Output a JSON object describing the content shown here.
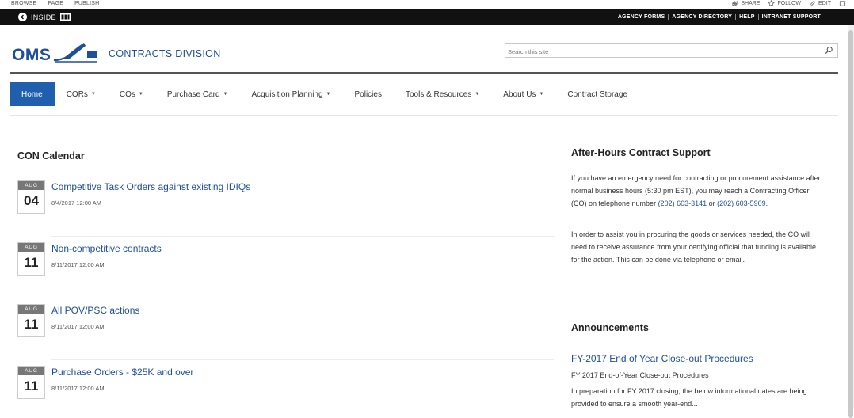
{
  "ribbon": {
    "tabs": [
      "BROWSE",
      "PAGE",
      "PUBLISH"
    ],
    "share": "SHARE",
    "follow": "FOLLOW",
    "edit": "EDIT"
  },
  "topbar": {
    "inside_label": "INSIDE",
    "links": [
      "AGENCY FORMS",
      "AGENCY DIRECTORY",
      "HELP",
      "INTRANET SUPPORT"
    ]
  },
  "header": {
    "logo_text": "OMS",
    "division": "CONTRACTS DIVISION",
    "search_placeholder": "Search this site"
  },
  "nav": {
    "items": [
      {
        "label": "Home",
        "dropdown": false,
        "active": true
      },
      {
        "label": "CORs",
        "dropdown": true
      },
      {
        "label": "COs",
        "dropdown": true
      },
      {
        "label": "Purchase Card",
        "dropdown": true
      },
      {
        "label": "Acquisition Planning",
        "dropdown": true
      },
      {
        "label": "Policies",
        "dropdown": false
      },
      {
        "label": "Tools & Resources",
        "dropdown": true
      },
      {
        "label": "About Us",
        "dropdown": true
      },
      {
        "label": "Contract Storage",
        "dropdown": false
      }
    ],
    "caret": "▼"
  },
  "calendar": {
    "title": "CON Calendar",
    "events": [
      {
        "month": "AUG",
        "day": "04",
        "title": "Competitive Task Orders against existing IDIQs",
        "time": "8/4/2017 12:00 AM"
      },
      {
        "month": "AUG",
        "day": "11",
        "title": "Non-competitive contracts",
        "time": "8/11/2017 12:00 AM"
      },
      {
        "month": "AUG",
        "day": "11",
        "title": "All POV/PSC actions",
        "time": "8/11/2017 12:00 AM"
      },
      {
        "month": "AUG",
        "day": "11",
        "title": "Purchase Orders - $25K and over",
        "time": "8/11/2017 12:00 AM"
      }
    ]
  },
  "after_hours": {
    "title": "After-Hours Contract Support",
    "p1_before": "If you have an emergency need for contracting or procurement assistance after normal business hours (5:30 pm EST), you may reach a Contracting Officer (CO) on telephone number ",
    "phone1": "(202) 603-3141",
    "p1_mid": " or ",
    "phone2": "(202) 603-5909",
    "p1_after": ".",
    "p2": "In order to assist you in procuring the goods or services needed, the CO will need to receive assurance from your certifying official that funding is available for the action. This can be done via telephone or email."
  },
  "announcements": {
    "title": "Announcements",
    "item_title": "FY-2017 End of Year Close-out Procedures",
    "item_sub": "FY 2017 End-of-Year Close-out Procedures",
    "item_text": "In preparation for FY 2017 closing, the below informational dates are being provided to ensure a smooth year-end..."
  },
  "colors": {
    "brand_blue": "#1f4e9a",
    "nav_active": "#1f5fae",
    "topbar": "#111111",
    "date_month_bg": "#777777"
  }
}
